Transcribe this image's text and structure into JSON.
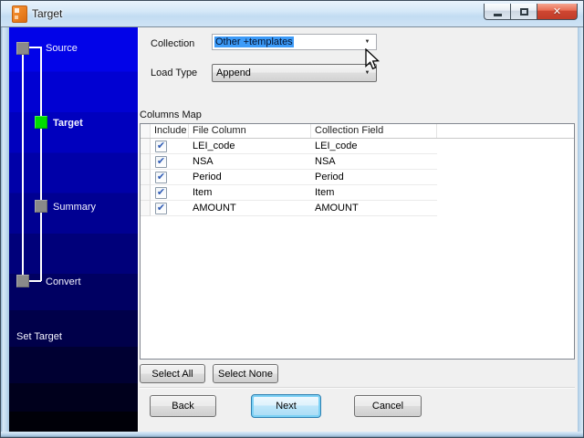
{
  "window": {
    "title": "Target"
  },
  "titlebar": {
    "controls": {
      "minimize": "minimize",
      "maximize": "maximize",
      "close_glyph": "✕"
    }
  },
  "sidebar": {
    "steps": [
      {
        "label": "Source",
        "state": "pending"
      },
      {
        "label": "Target",
        "state": "active"
      },
      {
        "label": "Summary",
        "state": "pending"
      },
      {
        "label": "Convert",
        "state": "pending"
      }
    ],
    "status": "Set Target"
  },
  "form": {
    "collection_label": "Collection",
    "collection_value": "Other +templates",
    "load_type_label": "Load Type",
    "load_type_value": "Append"
  },
  "columns_map": {
    "title": "Columns Map",
    "headers": [
      "Include",
      "File Column",
      "Collection Field"
    ],
    "rows": [
      {
        "include": true,
        "file_column": "LEI_code",
        "collection_field": "LEI_code"
      },
      {
        "include": true,
        "file_column": "NSA",
        "collection_field": "NSA"
      },
      {
        "include": true,
        "file_column": "Period",
        "collection_field": "Period"
      },
      {
        "include": true,
        "file_column": "Item",
        "collection_field": "Item"
      },
      {
        "include": true,
        "file_column": "AMOUNT",
        "collection_field": "AMOUNT"
      }
    ]
  },
  "actions": {
    "select_all": "Select All",
    "select_none": "Select None",
    "back": "Back",
    "next": "Next",
    "cancel": "Cancel"
  },
  "icons": {
    "check": "✔",
    "dropdown_arrow": "▼",
    "close": "✕"
  },
  "colors": {
    "active_step_green": "#00dc00",
    "step_gray": "#8a8a8a",
    "selection_blue": "#3d9bf8",
    "sidebar_top_blue": "#0203e8",
    "sidebar_bottom": "#000000",
    "close_button_red": "#ce4732"
  }
}
